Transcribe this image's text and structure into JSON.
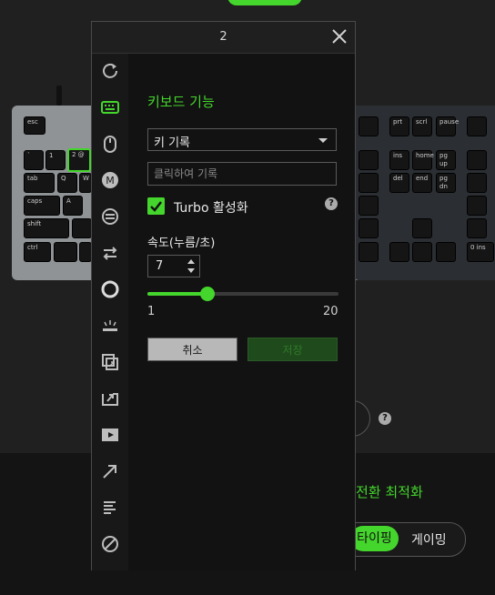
{
  "app": {
    "accent": "#44d62c"
  },
  "background": {
    "keyboard_keys": [
      {
        "label": "esc"
      },
      {
        "label": "`"
      },
      {
        "label": "1"
      },
      {
        "label": "2 @"
      },
      {
        "label": "tab"
      },
      {
        "label": "Q"
      },
      {
        "label": "W"
      },
      {
        "label": "caps"
      },
      {
        "label": "A"
      },
      {
        "label": "shift"
      },
      {
        "label": "ctrl"
      },
      {
        "label": "prt"
      },
      {
        "label": "scrl"
      },
      {
        "label": "pause"
      },
      {
        "label": "ins"
      },
      {
        "label": "home"
      },
      {
        "label": "pg up"
      },
      {
        "label": "del"
      },
      {
        "label": "end"
      },
      {
        "label": "pg dn"
      },
      {
        "label": "0 ins"
      }
    ],
    "optimize_title": "전환 최적화",
    "mode_typing": "타이핑",
    "mode_gaming": "게이밍",
    "help_symbol": "?"
  },
  "dialog": {
    "title": "2",
    "close_icon": "close-icon",
    "rail_icons": [
      {
        "name": "reset-icon",
        "active": false
      },
      {
        "name": "keyboard-icon",
        "active": true
      },
      {
        "name": "mouse-icon",
        "active": false
      },
      {
        "name": "macro-icon",
        "active": false
      },
      {
        "name": "hypershift-icon",
        "active": false
      },
      {
        "name": "switch-profile-icon",
        "active": false
      },
      {
        "name": "lighting-icon",
        "active": false
      },
      {
        "name": "backlight-icon",
        "active": false
      },
      {
        "name": "inter-device-icon",
        "active": false
      },
      {
        "name": "launch-program-icon",
        "active": false
      },
      {
        "name": "multimedia-icon",
        "active": false
      },
      {
        "name": "shortcut-icon",
        "active": false
      },
      {
        "name": "text-function-icon",
        "active": false
      },
      {
        "name": "disable-icon",
        "active": false
      }
    ],
    "section_title": "키보드 기능",
    "function_select": {
      "value": "키 기록"
    },
    "key_input": {
      "placeholder": "클릭하여 기록",
      "value": ""
    },
    "turbo": {
      "label": "Turbo 활성화",
      "checked": true,
      "help": "?"
    },
    "speed": {
      "label": "속도(누름/초)",
      "value": "7"
    },
    "slider": {
      "min": "1",
      "max": "20",
      "value": 7,
      "range": [
        1,
        20
      ]
    },
    "cancel_label": "취소",
    "save_label": "저장"
  }
}
